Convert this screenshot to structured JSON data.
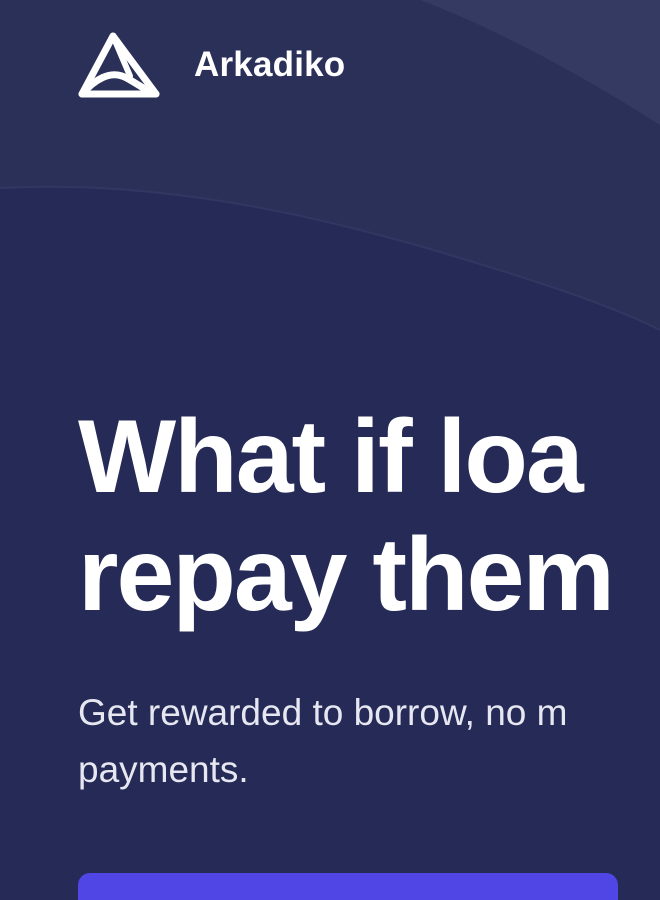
{
  "brand": {
    "name": "Arkadiko",
    "logo_icon": "arkadiko-logo-icon"
  },
  "hero": {
    "title_line_1": "What if loa",
    "title_line_2": "repay them",
    "subtitle_line_1": "Get rewarded to borrow, no m",
    "subtitle_line_2": "payments."
  },
  "cta": {
    "label": ""
  },
  "colors": {
    "background": "#252a56",
    "text": "#ffffff",
    "subtitle": "#e6e7f1",
    "accent": "#4f46e5"
  }
}
